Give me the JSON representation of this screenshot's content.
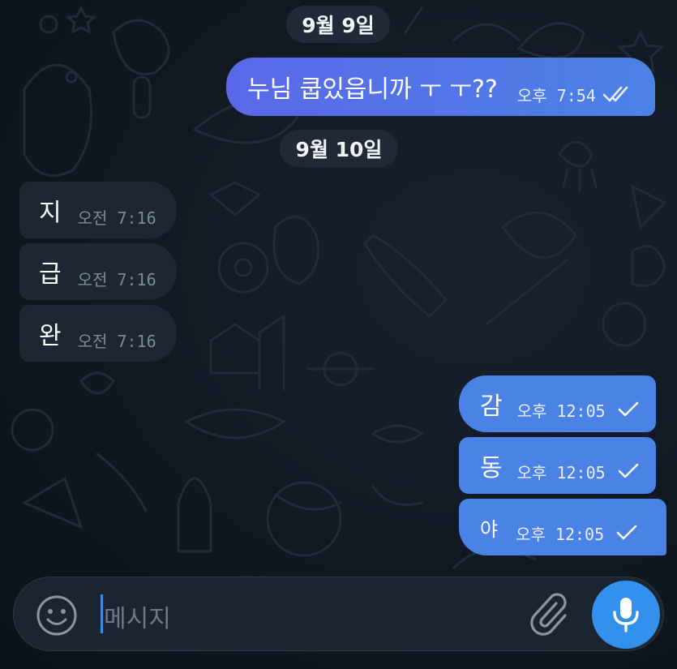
{
  "dates": {
    "first": "9월 9일",
    "second": "9월 10일"
  },
  "messages": [
    {
      "direction": "out",
      "text": "누님 쿱있읍니까 ㅜ ㅜ??",
      "time": "오후 7:54",
      "status": "read"
    },
    {
      "direction": "in",
      "text": "지",
      "time": "오전 7:16"
    },
    {
      "direction": "in",
      "text": "급",
      "time": "오전 7:16"
    },
    {
      "direction": "in",
      "text": "완",
      "time": "오전 7:16"
    },
    {
      "direction": "out",
      "text": "감",
      "time": "오후 12:05",
      "status": "sent"
    },
    {
      "direction": "out",
      "text": "동",
      "time": "오후 12:05",
      "status": "sent"
    },
    {
      "direction": "out",
      "text": "야",
      "time": "오후 12:05",
      "status": "sent"
    }
  ],
  "composer": {
    "placeholder": "메시지"
  },
  "icons": {
    "emoji": "smiley-face-icon",
    "attach": "paperclip-icon",
    "send_voice": "microphone-icon",
    "read_status": "double-check-icon",
    "sent_status": "single-check-icon"
  },
  "colors": {
    "background": "#0e1621",
    "outgoing_bubble": "#4b82e6",
    "incoming_bubble": "#1d2733",
    "accent": "#3390ec"
  }
}
